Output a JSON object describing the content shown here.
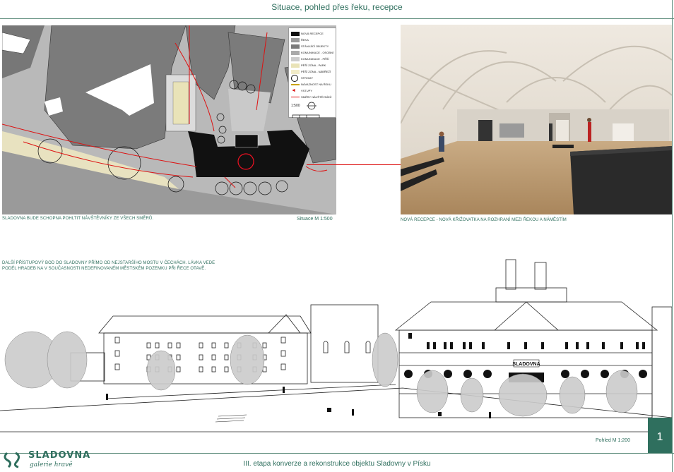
{
  "header": {
    "title": "Situace, pohled přes řeku, recepce"
  },
  "site_plan": {
    "caption": "SLADOVNA BUDE SCHOPNA POHLTIT NÁVŠTĚVNÍKY ZE VŠECH SMĚRŮ.",
    "scale": "Situace M 1:500",
    "legend": [
      "NOVÁ RECEPCE",
      "ŘEKA",
      "STÁVAJÍCÍ OBJEKTY",
      "KOMUNIKACE - OSOBNÍ",
      "KOMUNIKACE - PĚŠÍ",
      "PĚŠÍ ZÓNA - PARK",
      "PĚŠÍ ZÓNA - NÁBŘEŽÍ",
      "STROMY",
      "NÁVAZNOST NA ŘEKU",
      "VSTUPY",
      "SMĚRY NÁVŠTĚVNÍKŮ"
    ],
    "legend_scale": "1:500"
  },
  "interior": {
    "caption": "NOVÁ RECEPCE - NOVÁ KŘIŽOVATKA NA ROZHRANÍ MEZI ŘEKOU A NÁMĚSTÍM"
  },
  "elevation": {
    "note": "DALŠÍ PŘÍSTUPOVÝ BOD DO SLADOVNY PŘÍMO OD NEJSTARŠÍHO MOSTU V ČECHÁCH. LÁVKA VEDE PODÉL HRADEB NA V SOUČASNOSTI NEDEFINOVANÉM MĚSTSKÉM POZEMKU PŘI ŘECE OTAVĚ.",
    "scale": "Pohled M 1:200",
    "sign": "SLADOVNA"
  },
  "footer": {
    "title": "III. etapa konverze a rekonstrukce objektu Sladovny v Písku",
    "page": "1"
  },
  "logo": {
    "name": "SLADOVNA",
    "sub": "galerie hravě"
  }
}
